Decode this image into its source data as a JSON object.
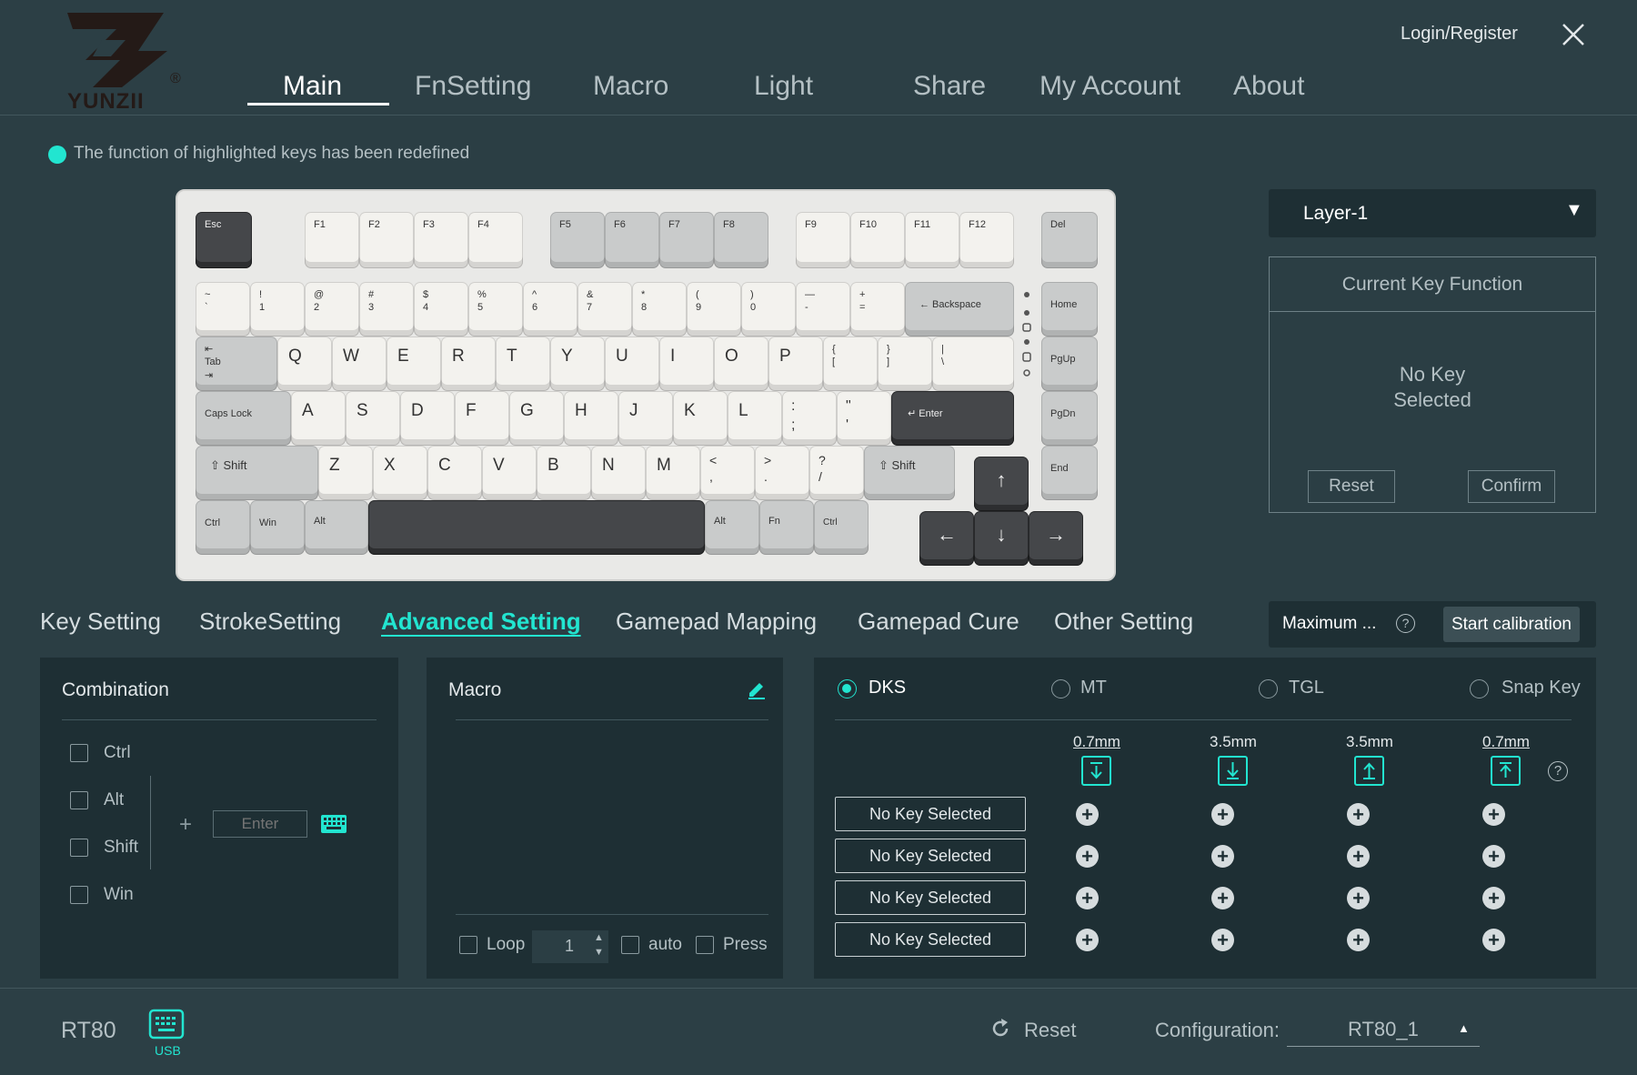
{
  "brand": {
    "name": "YUNZII",
    "reg_mark": "®"
  },
  "nav": {
    "tabs": [
      "Main",
      "FnSetting",
      "Macro",
      "Light",
      "Share",
      "My Account",
      "About"
    ],
    "active": "Main",
    "login": "Login/Register"
  },
  "notice": "The function of highlighted keys has been redefined",
  "keyboard": {
    "keys": [
      "Esc",
      "F1",
      "F2",
      "F3",
      "F4",
      "F5",
      "F6",
      "F7",
      "F8",
      "F9",
      "F10",
      "F11",
      "F12",
      "Del",
      "~\n`",
      "!\n1",
      "@\n2",
      "#\n3",
      "$\n4",
      "%\n5",
      "^\n6",
      "&\n7",
      "*\n8",
      "(\n9",
      ")\n0",
      "—\n-",
      "+\n=",
      "← Backspace",
      "Home",
      "⇤\nTab\n⇥",
      "Q",
      "W",
      "E",
      "R",
      "T",
      "Y",
      "U",
      "I",
      "O",
      "P",
      "{\n[",
      "}\n]",
      "|\n\\",
      "PgUp",
      "Caps Lock",
      "A",
      "S",
      "D",
      "F",
      "G",
      "H",
      "J",
      "K",
      "L",
      ":\n;",
      "\"\n'",
      "↵ Enter",
      "PgDn",
      "⇧ Shift",
      "Z",
      "X",
      "C",
      "V",
      "B",
      "N",
      "M",
      "<\n,",
      ">\n.",
      "?\n/",
      "⇧ Shift",
      "↑",
      "End",
      "Ctrl",
      "Win",
      "Alt",
      "",
      "Alt",
      "Fn",
      "Ctrl",
      "←",
      "↓",
      "→"
    ]
  },
  "layer": {
    "selected": "Layer-1"
  },
  "current_key_function": {
    "title": "Current Key Function",
    "value": "No Key\nSelected",
    "reset": "Reset",
    "confirm": "Confirm"
  },
  "sub_tabs": [
    "Key Setting",
    "StrokeSetting",
    "Advanced Setting",
    "Gamepad Mapping",
    "Gamepad Cure",
    "Other Setting"
  ],
  "sub_tab_active": "Advanced Setting",
  "calibration": {
    "mode": "Maximum ...",
    "help": "?",
    "button": "Start calibration"
  },
  "combination": {
    "title": "Combination",
    "modifiers": [
      "Ctrl",
      "Alt",
      "Shift",
      "Win"
    ],
    "plus": "+",
    "input_placeholder": "Enter"
  },
  "macro_panel": {
    "title": "Macro",
    "loop_label": "Loop",
    "loop_count": "1",
    "auto_label": "auto",
    "press_label": "Press"
  },
  "dks": {
    "modes": [
      "DKS",
      "MT",
      "TGL",
      "Snap Key"
    ],
    "selected": "DKS",
    "travel": [
      "0.7mm",
      "3.5mm",
      "3.5mm",
      "0.7mm"
    ],
    "slots": [
      "No Key Selected",
      "No Key Selected",
      "No Key Selected",
      "No Key Selected"
    ],
    "help": "?"
  },
  "footer": {
    "device": "RT80",
    "connection": "USB",
    "reset": "Reset",
    "config_label": "Configuration:",
    "config_value": "RT80_1"
  },
  "colors": {
    "accent": "#22e5d0",
    "background": "#2b3e44",
    "panel": "#1e2f34"
  }
}
